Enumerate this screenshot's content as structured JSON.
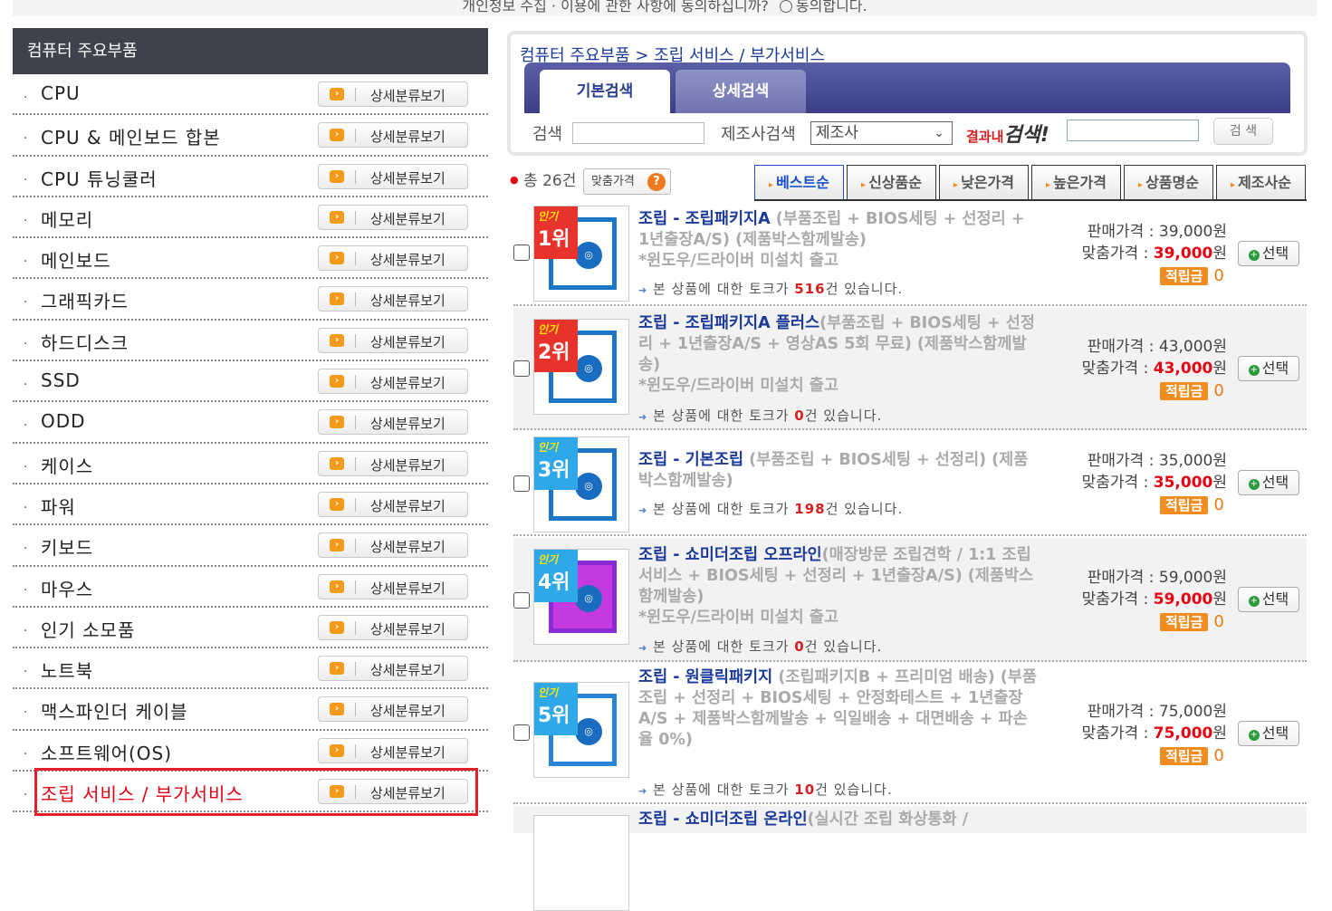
{
  "consent": {
    "question": "개인정보 수집 · 이용에 관한 사항에 동의하십니까?",
    "agree": "동의합니다."
  },
  "sidebar": {
    "title": "컴퓨터 주요부품",
    "detail_label": "상세분류보기",
    "items": [
      {
        "label": "CPU"
      },
      {
        "label": "CPU & 메인보드 합본"
      },
      {
        "label": "CPU 튜닝쿨러"
      },
      {
        "label": "메모리"
      },
      {
        "label": "메인보드"
      },
      {
        "label": "그래픽카드"
      },
      {
        "label": "하드디스크"
      },
      {
        "label": "SSD"
      },
      {
        "label": "ODD"
      },
      {
        "label": "케이스"
      },
      {
        "label": "파워"
      },
      {
        "label": "키보드"
      },
      {
        "label": "마우스"
      },
      {
        "label": "인기 소모품"
      },
      {
        "label": "노트북"
      },
      {
        "label": "맥스파인더 케이블"
      },
      {
        "label": "소프트웨어(OS)"
      },
      {
        "label": "조립 서비스 / 부가서비스"
      }
    ]
  },
  "search": {
    "breadcrumb": "컴퓨터 주요부품 > 조립 서비스 / 부가서비스",
    "tab_basic": "기본검색",
    "tab_detail": "상세검색",
    "search_label": "검색",
    "maker_label": "제조사검색",
    "maker_select": "제조사",
    "within_prefix": "결과내",
    "within_big": "검색!",
    "button": "검 색"
  },
  "list": {
    "count_prefix": "총",
    "count": "26건",
    "custom_price_btn": "맞춤가격",
    "sort": [
      "베스트순",
      "신상품순",
      "낮은가격",
      "높은가격",
      "상품명순",
      "제조사순"
    ],
    "labels": {
      "sale": "판매가격 :",
      "custom": "맞춤가격 :",
      "point": "적립금",
      "select": "선택",
      "talk_pre": "본 상품에 대한 토크가",
      "talk_post": "건 있습니다."
    },
    "items": [
      {
        "rank_small": "인기",
        "rank": "1위",
        "name": "조립 - 조립패키지A",
        "desc": " (부품조립 + BIOS세팅 + 선정리 + 1년출장A/S) (제품박스함께발송)",
        "note": "*윈도우/드라이버 미설치 출고",
        "talk": "516",
        "sale": "39,000원",
        "custom": "39,000",
        "unit": "원",
        "point": "0"
      },
      {
        "rank_small": "인기",
        "rank": "2위",
        "name": "조립 - 조립패키지A 플러스",
        "desc": "(부품조립 + BIOS세팅 + 선정리 + 1년출장A/S + 영상AS 5회 무료) (제품박스함께발송)",
        "note": "*윈도우/드라이버 미설치 출고",
        "talk": "0",
        "sale": "43,000원",
        "custom": "43,000",
        "unit": "원",
        "point": "0"
      },
      {
        "rank_small": "인기",
        "rank": "3위",
        "name": "조립 - 기본조립",
        "desc": " (부품조립 + BIOS세팅 + 선정리) (제품박스함께발송)",
        "note": "",
        "talk": "198",
        "sale": "35,000원",
        "custom": "35,000",
        "unit": "원",
        "point": "0"
      },
      {
        "rank_small": "인기",
        "rank": "4위",
        "name": "조립 - 쇼미더조립 오프라인",
        "desc": "(매장방문 조립견학 / 1:1 조립 서비스 + BIOS세팅 + 선정리 + 1년출장A/S) (제품박스함께발송)",
        "note": "*윈도우/드라이버 미설치 출고",
        "talk": "0",
        "sale": "59,000원",
        "custom": "59,000",
        "unit": "원",
        "point": "0"
      },
      {
        "rank_small": "인기",
        "rank": "5위",
        "name": "조립 - 원클릭패키지",
        "desc": " (조립패키지B + 프리미엄 배송) (부품조립 + 선정리 + BIOS세팅 + 안정화테스트 + 1년출장A/S + 제품박스함께발송 + 익일배송 + 대면배송 + 파손율 0%)",
        "note": "",
        "talk": "10",
        "sale": "75,000원",
        "custom": "75,000",
        "unit": "원",
        "point": "0"
      }
    ],
    "partial_item": {
      "name": "조립 - 쇼미더조립 온라인",
      "desc": "(실시간 조립 화상통화 /"
    }
  }
}
